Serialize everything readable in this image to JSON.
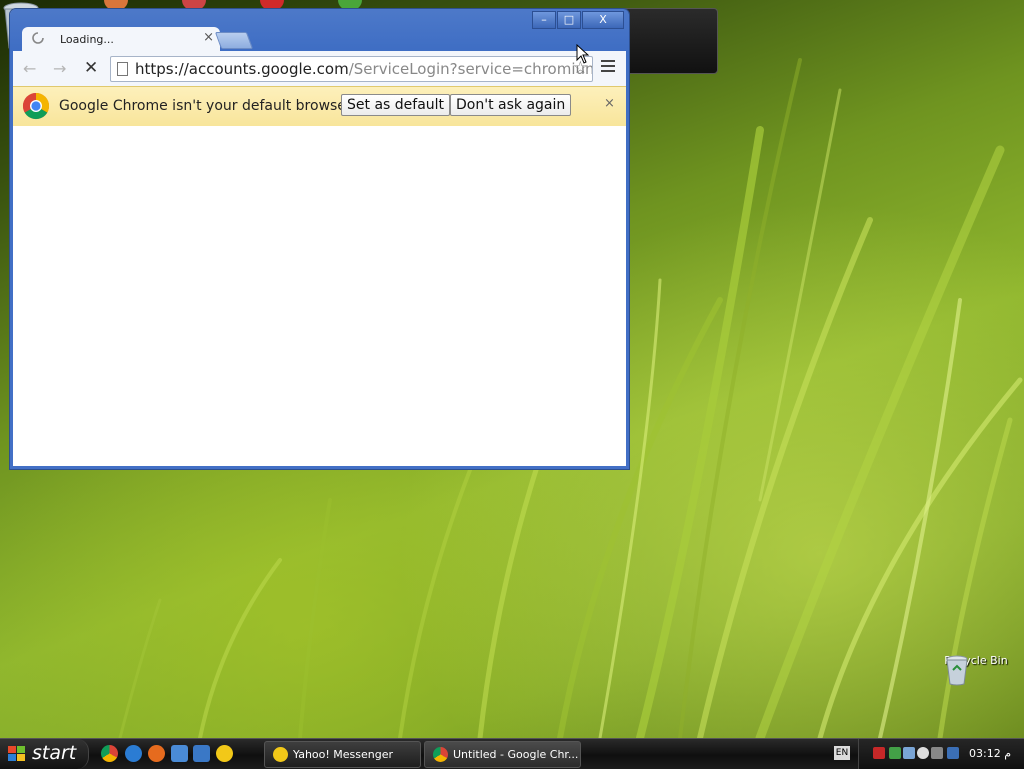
{
  "browser": {
    "tab_title": "Loading...",
    "tab_close": "×",
    "window_buttons": {
      "minimize": "–",
      "maximize": "□",
      "close": "X"
    },
    "url_host": "https://accounts.google.com",
    "url_path": "/ServiceLogin?service=chromiums",
    "star": "☆",
    "back": "←",
    "forward": "→",
    "stop": "✕"
  },
  "infobar": {
    "message": "Google Chrome isn't your default browser.",
    "set_default": "Set as default",
    "dont_ask": "Don't ask again",
    "close": "×"
  },
  "desktop": {
    "recycle_bin_label": "Recycle Bin"
  },
  "taskbar": {
    "start_label": "start",
    "tasks": [
      {
        "label": "Yahoo! Messenger"
      },
      {
        "label": "Untitled - Google Chr..."
      }
    ],
    "language": "EN",
    "clock": "03:12 م"
  },
  "colors": {
    "titlebar": "#4370c6",
    "infobar": "#f8e59b",
    "taskbar": "#1c1c1c"
  }
}
